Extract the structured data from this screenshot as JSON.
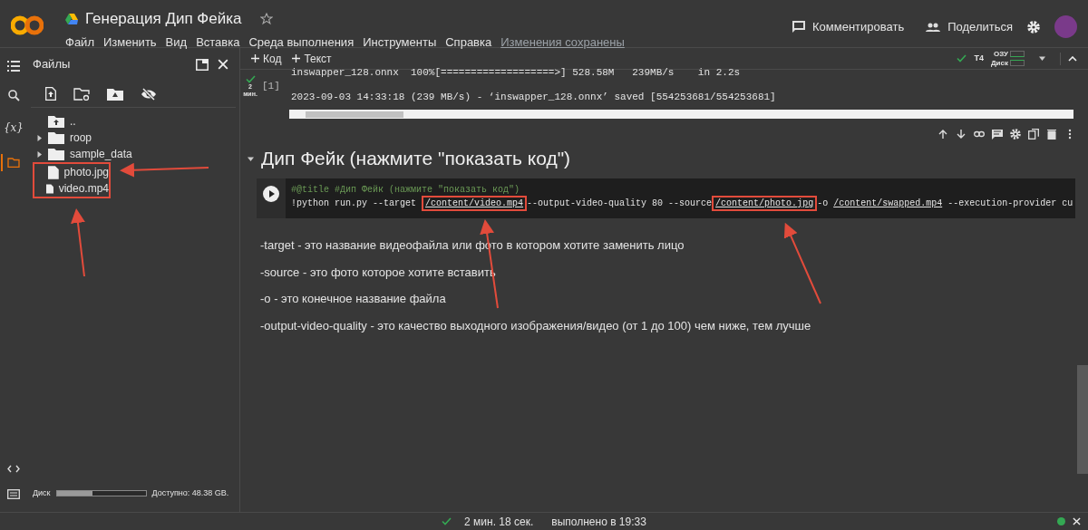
{
  "header": {
    "title": "Генерация Дип Фейка",
    "menu": [
      "Файл",
      "Изменить",
      "Вид",
      "Вставка",
      "Среда выполнения",
      "Инструменты",
      "Справка"
    ],
    "saved_status": "Изменения сохранены",
    "comment_button": "Комментировать",
    "share_button": "Поделиться"
  },
  "rail": {
    "variables_icon": "{x}"
  },
  "toolbar": {
    "add_code": "Код",
    "add_text": "Текст",
    "runtime": "T4",
    "ram_label": "ОЗУ",
    "disk_label": "Диск"
  },
  "sidebar": {
    "title": "Файлы",
    "files": [
      {
        "kind": "parent",
        "name": "..",
        "highlighted": false
      },
      {
        "kind": "folder",
        "name": "roop",
        "highlighted": false
      },
      {
        "kind": "folder",
        "name": "sample_data",
        "highlighted": false
      },
      {
        "kind": "file",
        "name": "photo.jpg",
        "highlighted": true
      },
      {
        "kind": "file",
        "name": "video.mp4",
        "highlighted": true
      }
    ],
    "disk": {
      "label": "Диск",
      "level": 0.4,
      "free": "Доступно: 48.38 GB."
    }
  },
  "output_cell": {
    "exec_count": "[1]",
    "duration": "2",
    "duration_unit": "мин.",
    "lines": [
      "inswapper_128.onnx  100%[===================>] 528.58M   239MB/s    in 2.2s",
      "2023-09-03 14:33:18 (239 MB/s) - ‘inswapper_128.onnx’ saved [554253681/554253681]"
    ]
  },
  "section": {
    "heading": "Дип Фейк (нажмите \"показать код\")",
    "expanded": true
  },
  "code_cell": {
    "comment": "#@title #Дип Фейк (нажмите \"показать код\")",
    "segments": [
      {
        "text": "!python run.py --target ",
        "underlined": false,
        "highlighted": false
      },
      {
        "text": "/content/video.mp4",
        "underlined": true,
        "highlighted": true
      },
      {
        "text": "--output-video-quality 80 --source",
        "underlined": false,
        "highlighted": false
      },
      {
        "text": "/content/photo.jpg",
        "underlined": true,
        "highlighted": true
      },
      {
        "text": "-o ",
        "underlined": false,
        "highlighted": false
      },
      {
        "text": "/content/swapped.mp4",
        "underlined": true,
        "highlighted": false
      },
      {
        "text": " --execution-provider cu",
        "underlined": false,
        "highlighted": false
      }
    ]
  },
  "notes": [
    "-target - это название видеофайла или фото в котором хотите заменить лицо",
    "-source - это фото которое хотите вставить",
    "-o - это конечное название файла",
    "-output-video-quality - это качество выходного изображения/видео (от 1 до 100) чем ниже, тем лучше"
  ],
  "status_bar": {
    "duration": "2 мин. 18 сек.",
    "completed": "выполнено в 19:33"
  }
}
